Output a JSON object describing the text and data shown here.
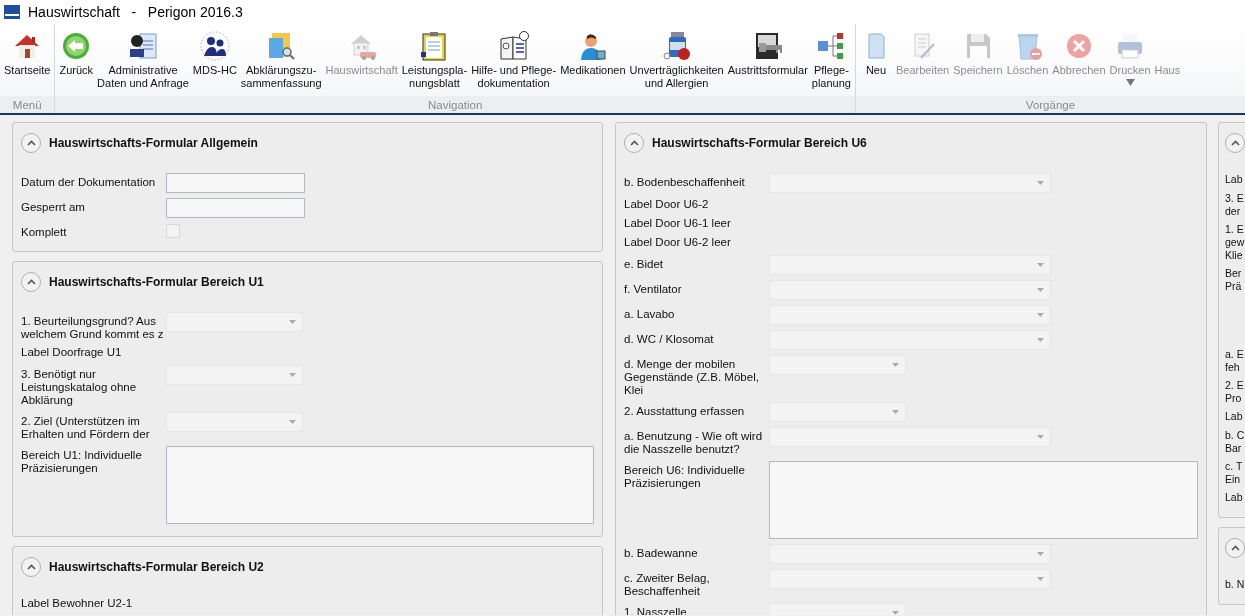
{
  "window": {
    "title": "Hauswirtschaft   -   Perigon 2016.3"
  },
  "ribbon": {
    "groups": [
      {
        "label": "Menü",
        "buttons": [
          {
            "label": "Startseite",
            "disabled": false
          }
        ]
      },
      {
        "label": "Navigation",
        "buttons": [
          {
            "label": "Zurück",
            "disabled": false
          },
          {
            "label": "Administrative\nDaten und Anfrage",
            "disabled": false
          },
          {
            "label": "MDS-HC",
            "disabled": false
          },
          {
            "label": "Abklärungszu-\nsammenfassung",
            "disabled": false
          },
          {
            "label": "Hauswirtschaft",
            "disabled": true
          },
          {
            "label": "Leistungspla-\nnungsblatt",
            "disabled": false
          },
          {
            "label": "Hilfe- und Pflege-\ndokumentation",
            "disabled": false
          },
          {
            "label": "Medikationen",
            "disabled": false
          },
          {
            "label": "Unverträglichkeiten\nund Allergien",
            "disabled": false
          },
          {
            "label": "Austrittsformular",
            "disabled": false
          },
          {
            "label": "Pflege-\nplanung",
            "disabled": false
          }
        ]
      },
      {
        "label": "Vorgänge",
        "buttons": [
          {
            "label": "Neu",
            "disabled": false
          },
          {
            "label": "Bearbeiten",
            "disabled": true
          },
          {
            "label": "Speichern",
            "disabled": true
          },
          {
            "label": "Löschen",
            "disabled": true
          },
          {
            "label": "Abbrechen",
            "disabled": true
          },
          {
            "label": "Drucken",
            "disabled": true,
            "has_menu": true
          },
          {
            "label": "Haus",
            "disabled": true
          }
        ]
      }
    ]
  },
  "columns": [
    {
      "panels": [
        {
          "title": "Hauswirtschafts-Formular Allgemein",
          "expanded": true,
          "rows": [
            {
              "label": "Datum der Dokumentation",
              "kind": "text"
            },
            {
              "label": "Gesperrt am",
              "kind": "text"
            },
            {
              "label": "Komplett",
              "kind": "checkbox",
              "checked": false
            }
          ]
        },
        {
          "title": "Hauswirtschafts-Formular Bereich U1",
          "expanded": true,
          "rows": [
            {
              "label": "1. Beurteilungsgrund? Aus welchem Grund kommt es z",
              "kind": "select"
            },
            {
              "label": "Label Doorfrage U1",
              "kind": "label"
            },
            {
              "label": "3. Benötigt nur Leistungskatalog ohne Abklärung",
              "kind": "select"
            },
            {
              "label": "2. Ziel (Unterstützen im Erhalten und Fördern der",
              "kind": "select"
            },
            {
              "label": "Bereich U1: Individuelle Präzisierungen",
              "kind": "textarea"
            }
          ]
        },
        {
          "title": "Hauswirtschafts-Formular Bereich U2",
          "expanded": true,
          "rows": [
            {
              "label": "Label Bewohner U2-1",
              "kind": "label"
            }
          ]
        }
      ]
    },
    {
      "panels": [
        {
          "title": "Hauswirtschafts-Formular Bereich U6",
          "expanded": true,
          "rows": [
            {
              "label": "b. Bodenbeschaffenheit",
              "kind": "longselect"
            },
            {
              "label": "Label Door U6-2",
              "kind": "label"
            },
            {
              "label": "Label Door U6-1 leer",
              "kind": "label"
            },
            {
              "label": "Label Door U6-2 leer",
              "kind": "label"
            },
            {
              "label": "e. Bidet",
              "kind": "longselect"
            },
            {
              "label": "f. Ventilator",
              "kind": "longselect"
            },
            {
              "label": "a. Lavabo",
              "kind": "longselect"
            },
            {
              "label": "d. WC / Klosomat",
              "kind": "longselect"
            },
            {
              "label": "d. Menge der mobilen Gegenstände (Z.B. Möbel, Klei",
              "kind": "select"
            },
            {
              "label": "2. Ausstattung erfassen",
              "kind": "select"
            },
            {
              "label": "a. Benutzung - Wie oft wird die Nasszelle benutzt?",
              "kind": "longselect"
            },
            {
              "label": "Bereich U6: Individuelle Präzisierungen",
              "kind": "textarea"
            },
            {
              "label": "b. Badewanne",
              "kind": "longselect"
            },
            {
              "label": "c. Zweiter Belag, Beschaffenheit",
              "kind": "longselect"
            },
            {
              "label": "1. Nasszelle",
              "kind": "select"
            }
          ]
        }
      ]
    },
    {
      "panels": [
        {
          "expanded": true,
          "rows": [
            {
              "label": "Lab",
              "kind": "label"
            },
            {
              "label": "3. E\nder",
              "kind": "label"
            },
            {
              "label": "1. E\ngew\nKlie",
              "kind": "label"
            },
            {
              "label": "Ber\nPrä",
              "kind": "tall"
            },
            {
              "label": "a. E\nfeh",
              "kind": "label"
            },
            {
              "label": "2. E\nPro",
              "kind": "label"
            },
            {
              "label": "Lab",
              "kind": "label"
            },
            {
              "label": "b. C\nBar",
              "kind": "label"
            },
            {
              "label": "c. T\nEin",
              "kind": "label"
            },
            {
              "label": "Lab",
              "kind": "label"
            }
          ]
        },
        {
          "expanded": true,
          "rows": [
            {
              "label": "b. N",
              "kind": "label"
            }
          ]
        }
      ]
    }
  ]
}
